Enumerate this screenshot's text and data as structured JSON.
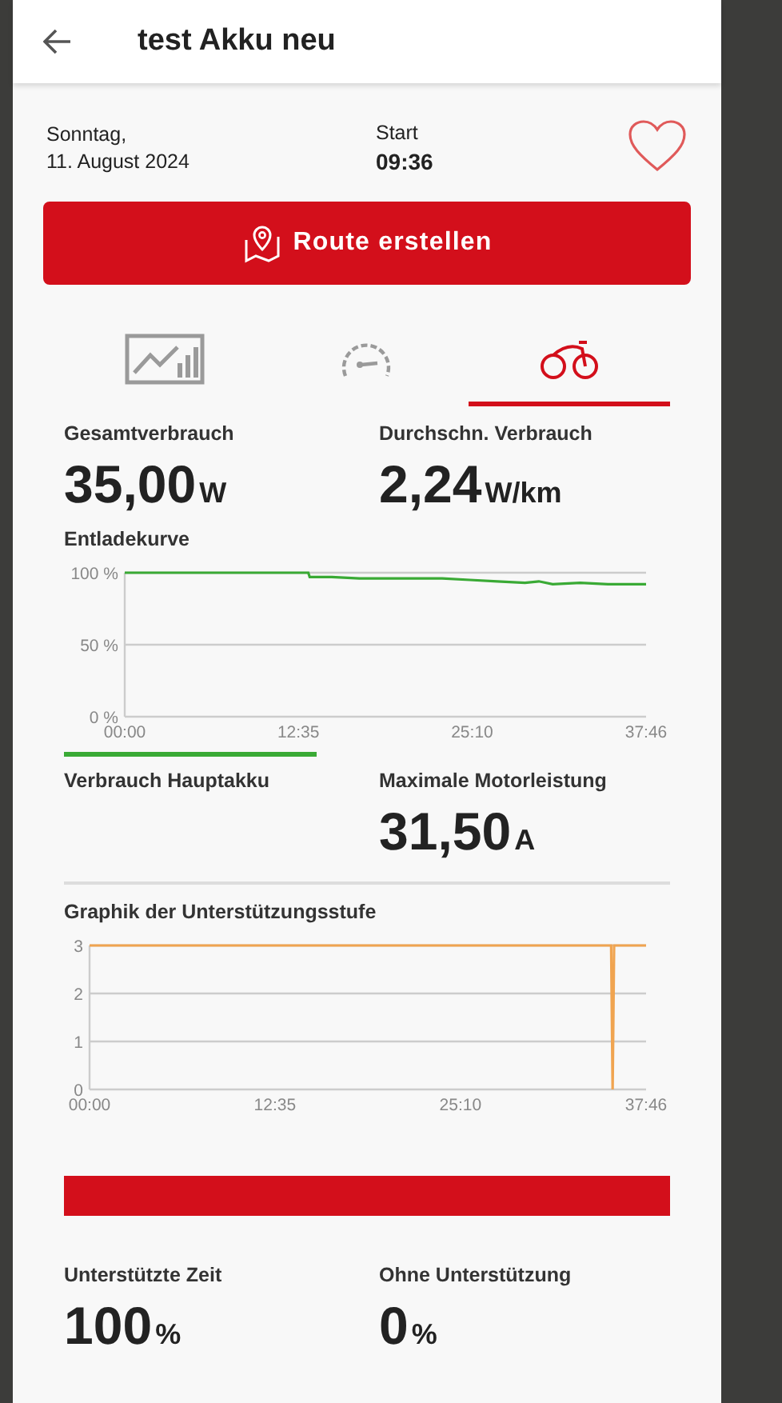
{
  "header": {
    "title": "test Akku neu"
  },
  "ride": {
    "date_line1": "Sonntag,",
    "date_line2": "11. August 2024",
    "start_label": "Start",
    "start_time": "09:36",
    "favorite": false
  },
  "route_button": {
    "label": "Route erstellen"
  },
  "tabs": [
    {
      "kind": "chart",
      "selected": false
    },
    {
      "kind": "gauge",
      "selected": false
    },
    {
      "kind": "bike",
      "selected": true
    }
  ],
  "stats_top": [
    {
      "label": "Gesamtverbrauch",
      "value": "35,00",
      "unit": "W"
    },
    {
      "label": "Durchschn. Verbrauch",
      "value": "2,24",
      "unit": "W/km"
    }
  ],
  "discharge": {
    "title": "Entladekurve",
    "chart_data": {
      "type": "line",
      "x": [
        0,
        5,
        10,
        13.3,
        13.4,
        15,
        17,
        20,
        23,
        25,
        27,
        29,
        30,
        31,
        33,
        35,
        37,
        37.77
      ],
      "series": [
        {
          "color": "#3aaa35",
          "values": [
            100,
            100,
            100,
            100,
            97,
            97,
            96,
            96,
            96,
            95,
            94,
            93,
            94,
            92,
            93,
            92,
            92,
            92
          ]
        }
      ],
      "xlim": [
        0,
        37.77
      ],
      "ylim": [
        0,
        100
      ],
      "xticks": [
        {
          "value": 0,
          "label": "00:00"
        },
        {
          "value": 12.58,
          "label": "12:35"
        },
        {
          "value": 25.17,
          "label": "25:10"
        },
        {
          "value": 37.77,
          "label": "37:46"
        }
      ],
      "yticks": [
        {
          "value": 0,
          "label": "0 %"
        },
        {
          "value": 50,
          "label": "50 %"
        },
        {
          "value": 100,
          "label": "100 %"
        }
      ]
    }
  },
  "stats_mid": [
    {
      "label": "Verbrauch Hauptakku"
    },
    {
      "label": "Maximale Motorleistung",
      "value": "31,50",
      "unit": "A"
    }
  ],
  "support": {
    "title": "Graphik der Unterstützungsstufe",
    "chart_data": {
      "type": "line",
      "x": [
        0,
        35.4,
        35.5,
        35.6,
        37.77
      ],
      "series": [
        {
          "color": "#f0a450",
          "values": [
            3,
            3,
            0,
            3,
            3
          ]
        }
      ],
      "xlim": [
        0,
        37.77
      ],
      "ylim": [
        0,
        3
      ],
      "xticks": [
        {
          "value": 0,
          "label": "00:00"
        },
        {
          "value": 12.58,
          "label": "12:35"
        },
        {
          "value": 25.17,
          "label": "25:10"
        },
        {
          "value": 37.77,
          "label": "37:46"
        }
      ],
      "yticks": [
        0,
        1,
        2,
        3
      ]
    }
  },
  "support_bar": {
    "level": 1
  },
  "stats_bottom": [
    {
      "label": "Unterstützte Zeit",
      "value": "100",
      "unit": "%"
    },
    {
      "label": "Ohne Unterstützung",
      "value": "0",
      "unit": "%"
    }
  ]
}
